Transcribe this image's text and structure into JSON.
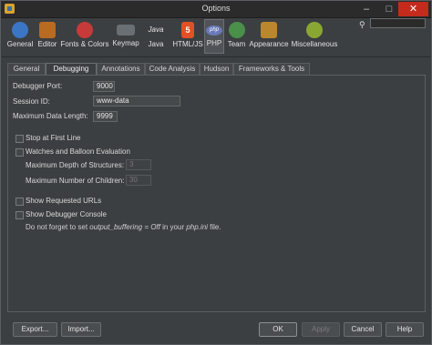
{
  "window": {
    "title": "Options"
  },
  "categories": [
    {
      "label": "General",
      "icon": "general-icon",
      "color": "#3b76c4"
    },
    {
      "label": "Editor",
      "icon": "editor-icon",
      "color": "#b96b22"
    },
    {
      "label": "Fonts & Colors",
      "icon": "fonts-colors-icon",
      "color": "#c63a3a"
    },
    {
      "label": "Keymap",
      "icon": "keymap-icon",
      "color": "#6a6f74"
    },
    {
      "label": "Java",
      "icon": "java-icon",
      "color": "#4a79b5"
    },
    {
      "label": "HTML/JS",
      "icon": "html5-icon",
      "color": "#e34f26"
    },
    {
      "label": "PHP",
      "icon": "php-icon",
      "color": "#6a7ab8"
    },
    {
      "label": "Team",
      "icon": "team-icon",
      "color": "#4a8f4a"
    },
    {
      "label": "Appearance",
      "icon": "appearance-icon",
      "color": "#b9872e"
    },
    {
      "label": "Miscellaneous",
      "icon": "miscellaneous-icon",
      "color": "#8aa632"
    }
  ],
  "search": {
    "placeholder": "",
    "value": ""
  },
  "tabs": [
    "General",
    "Debugging",
    "Annotations",
    "Code Analysis",
    "Hudson",
    "Frameworks & Tools"
  ],
  "active_tab": "Debugging",
  "form": {
    "debugger_port_label": "Debugger Port:",
    "debugger_port_value": "9000",
    "session_id_label": "Session ID:",
    "session_id_value": "www-data",
    "max_data_length_label": "Maximum Data Length:",
    "max_data_length_value": "9999",
    "stop_first_line_label": "Stop at First Line",
    "stop_first_line_checked": false,
    "watches_label": "Watches and Balloon Evaluation",
    "watches_checked": false,
    "max_depth_label": "Maximum Depth of Structures:",
    "max_depth_value": "3",
    "max_children_label": "Maximum Number of Children:",
    "max_children_value": "30",
    "show_urls_label": "Show Requested URLs",
    "show_urls_checked": false,
    "show_console_label": "Show Debugger Console",
    "show_console_checked": false,
    "note_prefix": "Do not forget to set ",
    "note_setting": "output_buffering = Off",
    "note_middle": " in your ",
    "note_file": "php.ini",
    "note_suffix": " file."
  },
  "buttons": {
    "export": "Export...",
    "import": "Import...",
    "ok": "OK",
    "apply": "Apply",
    "cancel": "Cancel",
    "help": "Help"
  }
}
